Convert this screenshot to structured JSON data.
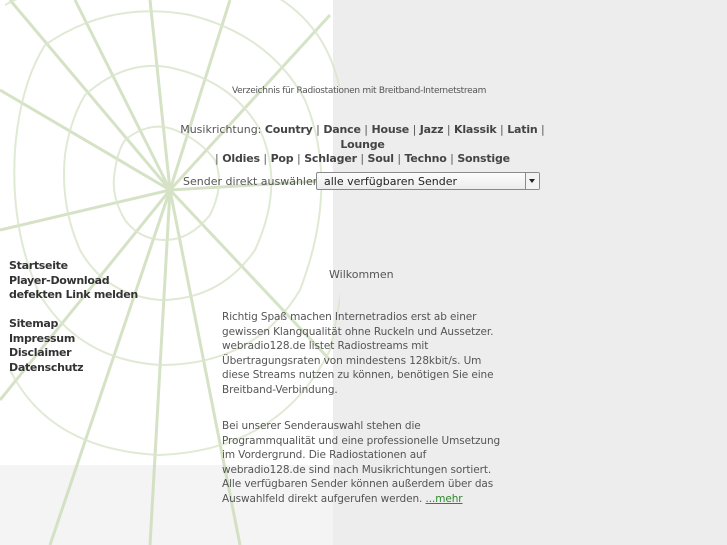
{
  "header": {
    "tagline": "Verzeichnis für Radiostationen mit Breitband-Internetstream"
  },
  "genres": {
    "label": "Musikrichtung:",
    "separator": "|",
    "row1": [
      "Country",
      "Dance",
      "House",
      "Jazz",
      "Klassik",
      "Latin",
      "Lounge"
    ],
    "row2": [
      "Oldies",
      "Pop",
      "Schlager",
      "Soul",
      "Techno",
      "Sonstige"
    ]
  },
  "sender": {
    "label": "Sender direkt auswählen:",
    "selected": "alle verfügbaren Sender"
  },
  "nav": {
    "items": [
      "Startseite",
      "Player-Download",
      "defekten Link melden"
    ],
    "items2": [
      "Sitemap",
      "Impressum",
      "Disclaimer",
      "Datenschutz"
    ]
  },
  "main": {
    "heading": "Wilkommen",
    "paragraph1": "Richtig Spaß machen Internetradios erst ab einer gewissen Klangqualität ohne Ruckeln und Aussetzer. webradio128.de listet Radiostreams mit Übertragungsraten von mindestens 128kbit/s. Um diese Streams nutzen zu können, benötigen Sie eine Breitband-Verbindung.",
    "paragraph2": "Bei unserer Senderauswahl stehen die Programmqualität und eine professionelle Umsetzung im Vordergrund. Die Radiostationen auf webradio128.de sind nach Musikrichtungen sortiert. Alle verfügbaren Sender können außerdem über das Auswahlfeld direkt aufgerufen werden.",
    "more_link": "...mehr"
  },
  "colors": {
    "right_panel": "#ededed",
    "link_green": "#2a8a2a",
    "web_lines": "#c9d9b5"
  }
}
